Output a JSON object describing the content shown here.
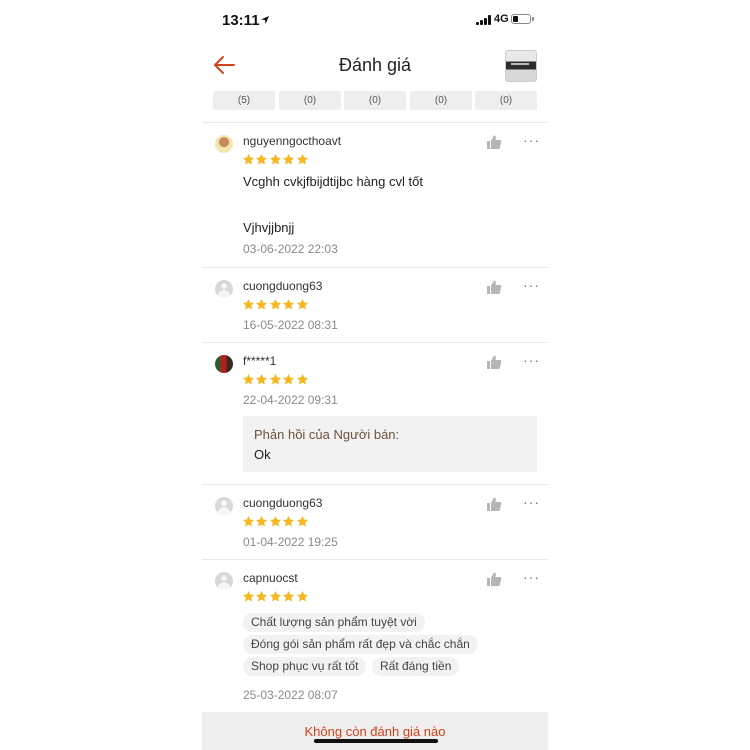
{
  "status_bar": {
    "time": "13:11",
    "network": "4G"
  },
  "header": {
    "title": "Đánh giá"
  },
  "filters": {
    "counts": [
      "(5)",
      "(0)",
      "(0)",
      "(0)",
      "(0)"
    ]
  },
  "colors": {
    "accent": "#d1421b",
    "star": "#f5b822"
  },
  "reviews": [
    {
      "username": "nguyenngocthoavt",
      "rating": 5,
      "comment_line1": "Vcghh cvkjfbijdtijbc hàng cvl tốt",
      "comment_line2": "Vjhvjjbnjj",
      "date": "03-06-2022 22:03"
    },
    {
      "username": "cuongduong63",
      "rating": 5,
      "date": "16-05-2022 08:31"
    },
    {
      "username": "f*****1",
      "rating": 5,
      "date": "22-04-2022 09:31",
      "reply_title": "Phản hồi của Người bán:",
      "reply_text": "Ok"
    },
    {
      "username": "cuongduong63",
      "rating": 5,
      "date": "01-04-2022 19:25"
    },
    {
      "username": "capnuocst",
      "rating": 5,
      "tags": [
        "Chất lượng sản phẩm tuyệt vời",
        "Đóng gói sản phẩm rất đẹp và chắc chắn",
        "Shop phục vụ rất tốt",
        "Rất đáng tiền"
      ],
      "date": "25-03-2022 08:07"
    }
  ],
  "footer": {
    "text": "Không còn đánh giá nào"
  }
}
